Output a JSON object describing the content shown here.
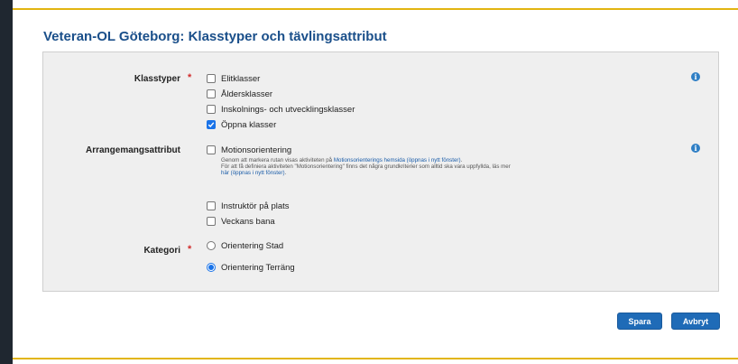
{
  "page": {
    "title": "Veteran-OL Göteborg: Klasstyper och tävlingsattribut"
  },
  "form": {
    "required_marker": "*",
    "klasstyper": {
      "label": "Klasstyper",
      "options": [
        {
          "label": "Elitklasser",
          "checked": false
        },
        {
          "label": "Åldersklasser",
          "checked": false
        },
        {
          "label": "Inskolnings- och utvecklingsklasser",
          "checked": false
        },
        {
          "label": "Öppna klasser",
          "checked": true
        }
      ]
    },
    "arrangemangsattribut": {
      "label": "Arrangemangsattribut",
      "motion": {
        "label": "Motionsorientering",
        "checked": false,
        "help1_pre": "Genom att markera rutan visas aktiviteten på ",
        "help1_link": "Motionsorienterings hemsida (öppnas i nytt fönster)",
        "help1_post": ".",
        "help2_pre": "För att få definiera aktiviteten \"Motionsorientering\" finns det några grundkriterier som alltid ska vara uppfyllda, läs mer ",
        "help2_link": "här (öppnas i nytt fönster)",
        "help2_post": "."
      },
      "instruktor": {
        "label": "Instruktör på plats",
        "checked": false
      },
      "veckans_bana": {
        "label": "Veckans bana",
        "checked": false
      }
    },
    "kategori": {
      "label": "Kategori",
      "options": [
        {
          "label": "Orientering Stad",
          "selected": false
        },
        {
          "label": "Orientering Terräng",
          "selected": true
        }
      ]
    }
  },
  "buttons": {
    "save": "Spara",
    "cancel": "Avbryt"
  },
  "colors": {
    "accent": "#e2b511",
    "title": "#1a4f8a",
    "button": "#1f6bb7",
    "required": "#d12b2b"
  }
}
